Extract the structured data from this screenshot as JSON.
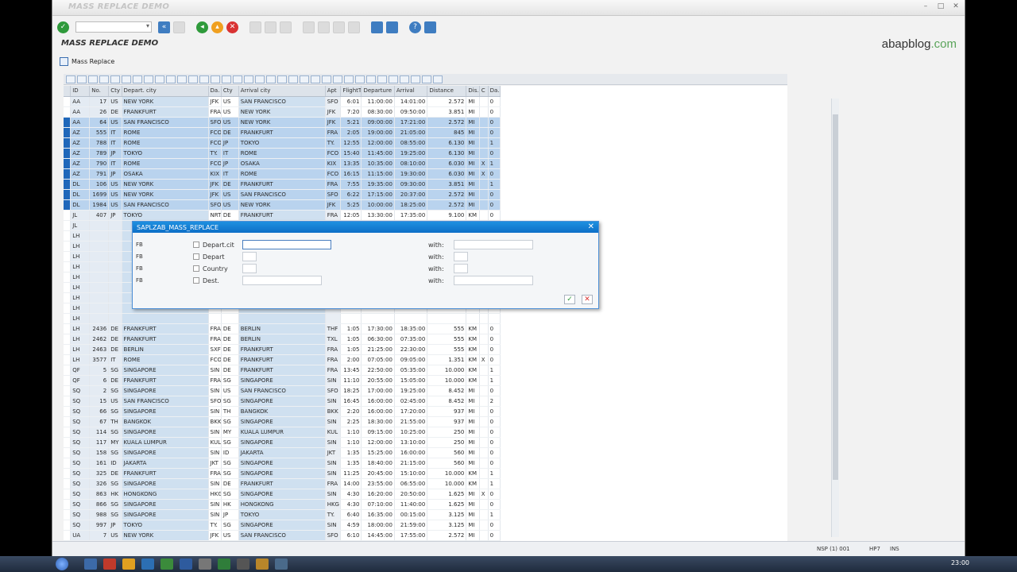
{
  "window": {
    "title": "MASS REPLACE DEMO",
    "screen_title": "MASS REPLACE DEMO"
  },
  "branding": {
    "logo_main": "abapblog",
    "logo_domain": ".com"
  },
  "appbar": {
    "mass_replace_label": "Mass Replace"
  },
  "grid": {
    "columns": [
      "ID",
      "No.",
      "Cty",
      "Depart. city",
      "Da.",
      "Cty",
      "Arrival city",
      "Apt",
      "FlightT",
      "Departure",
      "Arrival",
      "Distance",
      "Dis.",
      "C",
      "Da."
    ],
    "rows": [
      {
        "sel": false,
        "c": [
          "AA",
          "17",
          "US",
          "NEW YORK",
          "JFK",
          "US",
          "SAN FRANCISCO",
          "SFO",
          "6:01",
          "11:00:00",
          "14:01:00",
          "2.572",
          "MI",
          "",
          "0"
        ]
      },
      {
        "sel": false,
        "c": [
          "AA",
          "26",
          "DE",
          "FRANKFURT",
          "FRA",
          "US",
          "NEW YORK",
          "JFK",
          "7:20",
          "08:30:00",
          "09:50:00",
          "3.851",
          "MI",
          "",
          "0"
        ]
      },
      {
        "sel": true,
        "c": [
          "AA",
          "64",
          "US",
          "SAN FRANCISCO",
          "SFO",
          "US",
          "NEW YORK",
          "JFK",
          "5:21",
          "09:00:00",
          "17:21:00",
          "2.572",
          "MI",
          "",
          "0"
        ]
      },
      {
        "sel": true,
        "c": [
          "AZ",
          "555",
          "IT",
          "ROME",
          "FCO",
          "DE",
          "FRANKFURT",
          "FRA",
          "2:05",
          "19:00:00",
          "21:05:00",
          "845",
          "MI",
          "",
          "0"
        ]
      },
      {
        "sel": true,
        "c": [
          "AZ",
          "788",
          "IT",
          "ROME",
          "FCO",
          "JP",
          "TOKYO",
          "TY.",
          "12:55",
          "12:00:00",
          "08:55:00",
          "6.130",
          "MI",
          "",
          "1"
        ]
      },
      {
        "sel": true,
        "c": [
          "AZ",
          "789",
          "JP",
          "TOKYO",
          "TY.",
          "IT",
          "ROME",
          "FCO",
          "15:40",
          "11:45:00",
          "19:25:00",
          "6.130",
          "MI",
          "",
          "0"
        ]
      },
      {
        "sel": true,
        "c": [
          "AZ",
          "790",
          "IT",
          "ROME",
          "FCO",
          "JP",
          "OSAKA",
          "KIX",
          "13:35",
          "10:35:00",
          "08:10:00",
          "6.030",
          "MI",
          "X",
          "1"
        ]
      },
      {
        "sel": true,
        "c": [
          "AZ",
          "791",
          "JP",
          "OSAKA",
          "KIX",
          "IT",
          "ROME",
          "FCO",
          "16:15",
          "11:15:00",
          "19:30:00",
          "6.030",
          "MI",
          "X",
          "0"
        ]
      },
      {
        "sel": true,
        "c": [
          "DL",
          "106",
          "US",
          "NEW YORK",
          "JFK",
          "DE",
          "FRANKFURT",
          "FRA",
          "7:55",
          "19:35:00",
          "09:30:00",
          "3.851",
          "MI",
          "",
          "1"
        ]
      },
      {
        "sel": true,
        "c": [
          "DL",
          "1699",
          "US",
          "NEW YORK",
          "JFK",
          "US",
          "SAN FRANCISCO",
          "SFO",
          "6:22",
          "17:15:00",
          "20:37:00",
          "2.572",
          "MI",
          "",
          "0"
        ]
      },
      {
        "sel": true,
        "c": [
          "DL",
          "1984",
          "US",
          "SAN FRANCISCO",
          "SFO",
          "US",
          "NEW YORK",
          "JFK",
          "5:25",
          "10:00:00",
          "18:25:00",
          "2.572",
          "MI",
          "",
          "0"
        ]
      },
      {
        "sel": false,
        "c": [
          "JL",
          "407",
          "JP",
          "TOKYO",
          "NRT",
          "DE",
          "FRANKFURT",
          "FRA",
          "12:05",
          "13:30:00",
          "17:35:00",
          "9.100",
          "KM",
          "",
          "0"
        ]
      },
      {
        "sel": false,
        "c": [
          "JL",
          "",
          "",
          "",
          "",
          "",
          "",
          "",
          "",
          "",
          "",
          "",
          "",
          "",
          ""
        ]
      },
      {
        "sel": false,
        "c": [
          "LH",
          "",
          "",
          "",
          "",
          "",
          "",
          "",
          "",
          "",
          "",
          "",
          "",
          "",
          ""
        ]
      },
      {
        "sel": false,
        "c": [
          "LH",
          "",
          "",
          "",
          "",
          "",
          "",
          "",
          "",
          "",
          "",
          "",
          "",
          "",
          ""
        ]
      },
      {
        "sel": false,
        "c": [
          "LH",
          "",
          "",
          "",
          "",
          "",
          "",
          "",
          "",
          "",
          "",
          "",
          "",
          "",
          ""
        ]
      },
      {
        "sel": false,
        "c": [
          "LH",
          "",
          "",
          "",
          "",
          "",
          "",
          "",
          "",
          "",
          "",
          "",
          "",
          "",
          ""
        ]
      },
      {
        "sel": false,
        "c": [
          "LH",
          "",
          "",
          "",
          "",
          "",
          "",
          "",
          "",
          "",
          "",
          "",
          "",
          "",
          ""
        ]
      },
      {
        "sel": false,
        "c": [
          "LH",
          "",
          "",
          "",
          "",
          "",
          "",
          "",
          "",
          "",
          "",
          "",
          "",
          "",
          ""
        ]
      },
      {
        "sel": false,
        "c": [
          "LH",
          "",
          "",
          "",
          "",
          "",
          "",
          "",
          "",
          "",
          "",
          "",
          "",
          "",
          ""
        ]
      },
      {
        "sel": false,
        "c": [
          "LH",
          "",
          "",
          "",
          "",
          "",
          "",
          "",
          "",
          "",
          "",
          "",
          "",
          "",
          ""
        ]
      },
      {
        "sel": false,
        "c": [
          "LH",
          "",
          "",
          "",
          "",
          "",
          "",
          "",
          "",
          "",
          "",
          "",
          "",
          "",
          ""
        ]
      },
      {
        "sel": false,
        "c": [
          "LH",
          "2436",
          "DE",
          "FRANKFURT",
          "FRA",
          "DE",
          "BERLIN",
          "THF",
          "1:05",
          "17:30:00",
          "18:35:00",
          "555",
          "KM",
          "",
          "0"
        ]
      },
      {
        "sel": false,
        "c": [
          "LH",
          "2462",
          "DE",
          "FRANKFURT",
          "FRA",
          "DE",
          "BERLIN",
          "TXL",
          "1:05",
          "06:30:00",
          "07:35:00",
          "555",
          "KM",
          "",
          "0"
        ]
      },
      {
        "sel": false,
        "c": [
          "LH",
          "2463",
          "DE",
          "BERLIN",
          "SXF",
          "DE",
          "FRANKFURT",
          "FRA",
          "1:05",
          "21:25:00",
          "22:30:00",
          "555",
          "KM",
          "",
          "0"
        ]
      },
      {
        "sel": false,
        "c": [
          "LH",
          "3577",
          "IT",
          "ROME",
          "FCO",
          "DE",
          "FRANKFURT",
          "FRA",
          "2:00",
          "07:05:00",
          "09:05:00",
          "1.351",
          "KM",
          "X",
          "0"
        ]
      },
      {
        "sel": false,
        "c": [
          "QF",
          "5",
          "SG",
          "SINGAPORE",
          "SIN",
          "DE",
          "FRANKFURT",
          "FRA",
          "13:45",
          "22:50:00",
          "05:35:00",
          "10.000",
          "KM",
          "",
          "1"
        ]
      },
      {
        "sel": false,
        "c": [
          "QF",
          "6",
          "DE",
          "FRANKFURT",
          "FRA",
          "SG",
          "SINGAPORE",
          "SIN",
          "11:10",
          "20:55:00",
          "15:05:00",
          "10.000",
          "KM",
          "",
          "1"
        ]
      },
      {
        "sel": false,
        "c": [
          "SQ",
          "2",
          "SG",
          "SINGAPORE",
          "SIN",
          "US",
          "SAN FRANCISCO",
          "SFO",
          "18:25",
          "17:00:00",
          "19:25:00",
          "8.452",
          "MI",
          "",
          "0"
        ]
      },
      {
        "sel": false,
        "c": [
          "SQ",
          "15",
          "US",
          "SAN FRANCISCO",
          "SFO",
          "SG",
          "SINGAPORE",
          "SIN",
          "16:45",
          "16:00:00",
          "02:45:00",
          "8.452",
          "MI",
          "",
          "2"
        ]
      },
      {
        "sel": false,
        "c": [
          "SQ",
          "66",
          "SG",
          "SINGAPORE",
          "SIN",
          "TH",
          "BANGKOK",
          "BKK",
          "2:20",
          "16:00:00",
          "17:20:00",
          "937",
          "MI",
          "",
          "0"
        ]
      },
      {
        "sel": false,
        "c": [
          "SQ",
          "67",
          "TH",
          "BANGKOK",
          "BKK",
          "SG",
          "SINGAPORE",
          "SIN",
          "2:25",
          "18:30:00",
          "21:55:00",
          "937",
          "MI",
          "",
          "0"
        ]
      },
      {
        "sel": false,
        "c": [
          "SQ",
          "114",
          "SG",
          "SINGAPORE",
          "SIN",
          "MY",
          "KUALA LUMPUR",
          "KUL",
          "1:10",
          "09:15:00",
          "10:25:00",
          "250",
          "MI",
          "",
          "0"
        ]
      },
      {
        "sel": false,
        "c": [
          "SQ",
          "117",
          "MY",
          "KUALA LUMPUR",
          "KUL",
          "SG",
          "SINGAPORE",
          "SIN",
          "1:10",
          "12:00:00",
          "13:10:00",
          "250",
          "MI",
          "",
          "0"
        ]
      },
      {
        "sel": false,
        "c": [
          "SQ",
          "158",
          "SG",
          "SINGAPORE",
          "SIN",
          "ID",
          "JAKARTA",
          "JKT",
          "1:35",
          "15:25:00",
          "16:00:00",
          "560",
          "MI",
          "",
          "0"
        ]
      },
      {
        "sel": false,
        "c": [
          "SQ",
          "161",
          "ID",
          "JAKARTA",
          "JKT",
          "SG",
          "SINGAPORE",
          "SIN",
          "1:35",
          "18:40:00",
          "21:15:00",
          "560",
          "MI",
          "",
          "0"
        ]
      },
      {
        "sel": false,
        "c": [
          "SQ",
          "325",
          "DE",
          "FRANKFURT",
          "FRA",
          "SG",
          "SINGAPORE",
          "SIN",
          "11:25",
          "20:45:00",
          "15:10:00",
          "10.000",
          "KM",
          "",
          "1"
        ]
      },
      {
        "sel": false,
        "c": [
          "SQ",
          "326",
          "SG",
          "SINGAPORE",
          "SIN",
          "DE",
          "FRANKFURT",
          "FRA",
          "14:00",
          "23:55:00",
          "06:55:00",
          "10.000",
          "KM",
          "",
          "1"
        ]
      },
      {
        "sel": false,
        "c": [
          "SQ",
          "863",
          "HK",
          "HONGKONG",
          "HKG",
          "SG",
          "SINGAPORE",
          "SIN",
          "4:30",
          "16:20:00",
          "20:50:00",
          "1.625",
          "MI",
          "X",
          "0"
        ]
      },
      {
        "sel": false,
        "c": [
          "SQ",
          "866",
          "SG",
          "SINGAPORE",
          "SIN",
          "HK",
          "HONGKONG",
          "HKG",
          "4:30",
          "07:10:00",
          "11:40:00",
          "1.625",
          "MI",
          "",
          "0"
        ]
      },
      {
        "sel": false,
        "c": [
          "SQ",
          "988",
          "SG",
          "SINGAPORE",
          "SIN",
          "JP",
          "TOKYO",
          "TY.",
          "6:40",
          "16:35:00",
          "00:15:00",
          "3.125",
          "MI",
          "",
          "1"
        ]
      },
      {
        "sel": false,
        "c": [
          "SQ",
          "997",
          "JP",
          "TOKYO",
          "TY.",
          "SG",
          "SINGAPORE",
          "SIN",
          "4:59",
          "18:00:00",
          "21:59:00",
          "3.125",
          "MI",
          "",
          "0"
        ]
      },
      {
        "sel": false,
        "c": [
          "UA",
          "7",
          "US",
          "NEW YORK",
          "JFK",
          "US",
          "SAN FRANCISCO",
          "SFO",
          "6:10",
          "14:45:00",
          "17:55:00",
          "2.572",
          "MI",
          "",
          "0"
        ]
      },
      {
        "sel": false,
        "c": [
          "UA",
          "941",
          "DE",
          "FRANKFURT",
          "FRA",
          "US",
          "SAN FRANCISCO",
          "SFO",
          "11:36",
          "14:30:00",
          "17:06:00",
          "5.685",
          "MI",
          "",
          "0"
        ]
      }
    ]
  },
  "dialog": {
    "title": "SAPLZAB_MASS_REPLACE",
    "rows": [
      {
        "fb": "FB",
        "label": "Depart.cit",
        "with": "with:"
      },
      {
        "fb": "FB",
        "label": "Depart",
        "with": "with:"
      },
      {
        "fb": "FB",
        "label": "Country",
        "with": "with:"
      },
      {
        "fb": "FB",
        "label": "Dest.",
        "with": "with:"
      }
    ]
  },
  "statusbar": {
    "system": "NSP (1) 001",
    "server": "HP7",
    "mode": "INS"
  },
  "taskbar": {
    "clock": "23:00"
  },
  "colors": {
    "selection": "#b9d3ee",
    "row_marker": "#1f67ba",
    "dialog_header": "#0d6fc7",
    "logo_accent": "#5aa45a"
  }
}
